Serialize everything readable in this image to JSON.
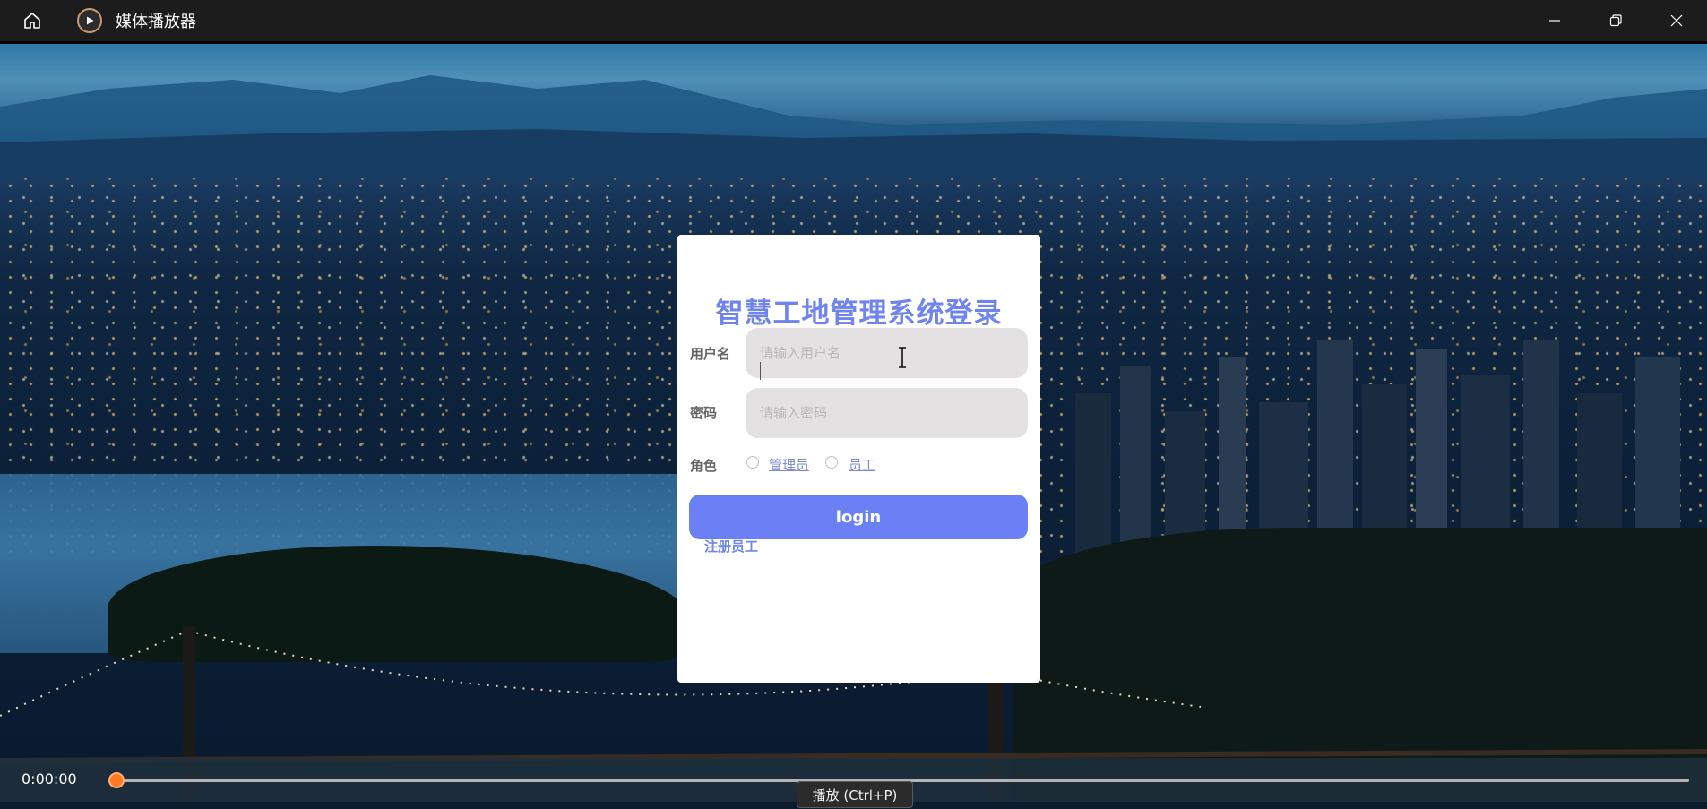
{
  "window": {
    "title": "媒体播放器",
    "home_icon": "home-icon",
    "app_icon": "play-circle-icon",
    "controls": [
      "minimize-icon",
      "restore-icon",
      "close-icon"
    ]
  },
  "login": {
    "title": "智慧工地管理系统登录",
    "username_label": "用户名",
    "username_placeholder": "请输入用户名",
    "password_label": "密码",
    "password_placeholder": "请输入密码",
    "role_label": "角色",
    "role_options": [
      "管理员",
      "员工"
    ],
    "login_button": "login",
    "register_link": "注册员工"
  },
  "player": {
    "time": "0:00:00",
    "progress": 0,
    "tooltip": "播放 (Ctrl+P)",
    "accent_color": "#ff7a20"
  },
  "colors": {
    "title_accent": "#6f84ef",
    "button": "#6c80f6"
  }
}
